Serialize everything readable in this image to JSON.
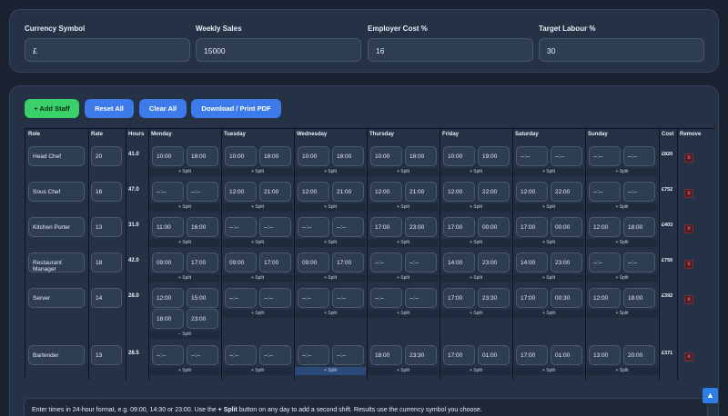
{
  "settings": {
    "currency_symbol": {
      "label": "Currency Symbol",
      "value": "£"
    },
    "weekly_sales": {
      "label": "Weekly Sales",
      "value": "15000"
    },
    "employer_cost": {
      "label": "Employer Cost %",
      "value": "16"
    },
    "target_labour": {
      "label": "Target Labour %",
      "value": "30"
    }
  },
  "toolbar": {
    "add_staff": "+ Add Staff",
    "reset_all": "Reset All",
    "clear_all": "Clear All",
    "download": "Download / Print PDF"
  },
  "table": {
    "headers": [
      "Role",
      "Rate",
      "Hours",
      "Monday",
      "Tuesday",
      "Wednesday",
      "Thursday",
      "Friday",
      "Saturday",
      "Sunday",
      "Cost",
      "Remove"
    ],
    "split_label": "+ Split",
    "unsplit_label": "− Split",
    "remove_label": "x",
    "rows": [
      {
        "role": "Head Chef",
        "rate": "20",
        "hours": "41.0",
        "cost": "£820",
        "days": [
          [
            "10:00",
            "18:00"
          ],
          [
            "10:00",
            "18:00"
          ],
          [
            "10:00",
            "18:00"
          ],
          [
            "10:00",
            "18:00"
          ],
          [
            "10:00",
            "19:00"
          ],
          [
            "--:--",
            "--:--"
          ],
          [
            "--:--",
            "--:--"
          ]
        ]
      },
      {
        "role": "Sous Chef",
        "rate": "16",
        "hours": "47.0",
        "cost": "£752",
        "days": [
          [
            "--:--",
            "--:--"
          ],
          [
            "12:00",
            "21:00"
          ],
          [
            "12:00",
            "21:00"
          ],
          [
            "12:00",
            "21:00"
          ],
          [
            "12:00",
            "22:00"
          ],
          [
            "12:00",
            "22:00"
          ],
          [
            "--:--",
            "--:--"
          ]
        ]
      },
      {
        "role": "Kitchen Porter",
        "rate": "13",
        "hours": "31.0",
        "cost": "£403",
        "days": [
          [
            "11:00",
            "16:00"
          ],
          [
            "--:--",
            "--:--"
          ],
          [
            "--:--",
            "--:--"
          ],
          [
            "17:00",
            "23:00"
          ],
          [
            "17:00",
            "00:00"
          ],
          [
            "17:00",
            "00:00"
          ],
          [
            "12:00",
            "18:00"
          ]
        ]
      },
      {
        "role": "Restaurant Manager",
        "rate": "18",
        "hours": "42.0",
        "cost": "£756",
        "days": [
          [
            "09:00",
            "17:00"
          ],
          [
            "09:00",
            "17:00"
          ],
          [
            "09:00",
            "17:00"
          ],
          [
            "--:--",
            "--:--"
          ],
          [
            "14:00",
            "23:00"
          ],
          [
            "14:00",
            "23:00"
          ],
          [
            "--:--",
            "--:--"
          ]
        ]
      },
      {
        "role": "Server",
        "rate": "14",
        "hours": "28.0",
        "cost": "£392",
        "days": [
          [
            "12:00",
            "15:00",
            "18:00",
            "23:00"
          ],
          [
            "--:--",
            "--:--"
          ],
          [
            "--:--",
            "--:--"
          ],
          [
            "--:--",
            "--:--"
          ],
          [
            "17:00",
            "23:30"
          ],
          [
            "17:00",
            "00:30"
          ],
          [
            "12:00",
            "18:00"
          ]
        ]
      },
      {
        "role": "Bartender",
        "rate": "13",
        "hours": "28.5",
        "cost": "£371",
        "days": [
          [
            "--:--",
            "--:--"
          ],
          [
            "--:--",
            "--:--"
          ],
          [
            "--:--",
            "--:--"
          ],
          [
            "18:00",
            "23:30"
          ],
          [
            "17:00",
            "01:00"
          ],
          [
            "17:00",
            "01:00"
          ],
          [
            "13:00",
            "20:00"
          ]
        ]
      }
    ]
  },
  "hint": {
    "before": "Enter times in 24-hour format, e.g. 09:00, 14:30 or 23:00. Use the ",
    "bold": "+ Split",
    "after": " button on any day to add a second shift. Results use the currency symbol you choose."
  }
}
